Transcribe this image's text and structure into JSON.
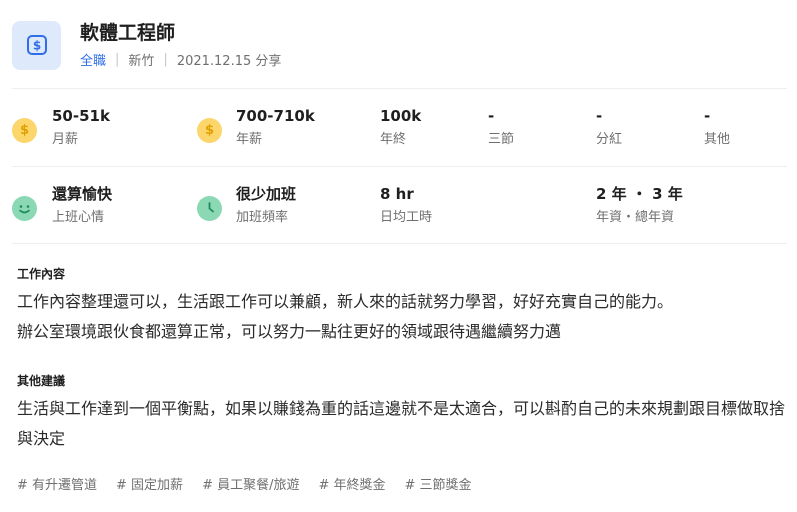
{
  "header": {
    "title": "軟體工程師",
    "type": "全職",
    "location": "新竹",
    "date_share": "2021.12.15 分享"
  },
  "salary": [
    {
      "value": "50-51k",
      "label": "月薪",
      "icon": "coin-icon"
    },
    {
      "value": "700-710k",
      "label": "年薪",
      "icon": "coin-icon"
    },
    {
      "value": "100k",
      "label": "年終"
    },
    {
      "value": "-",
      "label": "三節"
    },
    {
      "value": "-",
      "label": "分紅"
    },
    {
      "value": "-",
      "label": "其他"
    }
  ],
  "worklife": [
    {
      "value": "還算愉快",
      "label": "上班心情",
      "icon": "smile-icon"
    },
    {
      "value": "很少加班",
      "label": "加班頻率",
      "icon": "clock-icon"
    },
    {
      "value": "8 hr",
      "label": "日均工時"
    },
    {
      "value": "2 年 ・ 3 年",
      "label": "年資・總年資"
    }
  ],
  "content": {
    "title": "工作內容",
    "line1": "工作內容整理還可以，生活跟工作可以兼顧，新人來的話就努力學習，好好充實自己的能力。",
    "line2": "辦公室環境跟伙食都還算正常，可以努力一點往更好的領域跟待遇繼續努力邁"
  },
  "advice": {
    "title": "其他建議",
    "text": "生活與工作達到一個平衡點，如果以賺錢為重的話這邊就不是太適合，可以斟酌自己的未來規劃跟目標做取捨與決定"
  },
  "tags": [
    "# 有升遷管道",
    "# 固定加薪",
    "# 員工聚餐/旅遊",
    "# 年終獎金",
    "# 三節獎金"
  ],
  "colors": {
    "accent": "#2f6ee8",
    "coin": "#fcd66b",
    "green": "#8ad8b4",
    "logo_bg": "#dfe9fc"
  }
}
